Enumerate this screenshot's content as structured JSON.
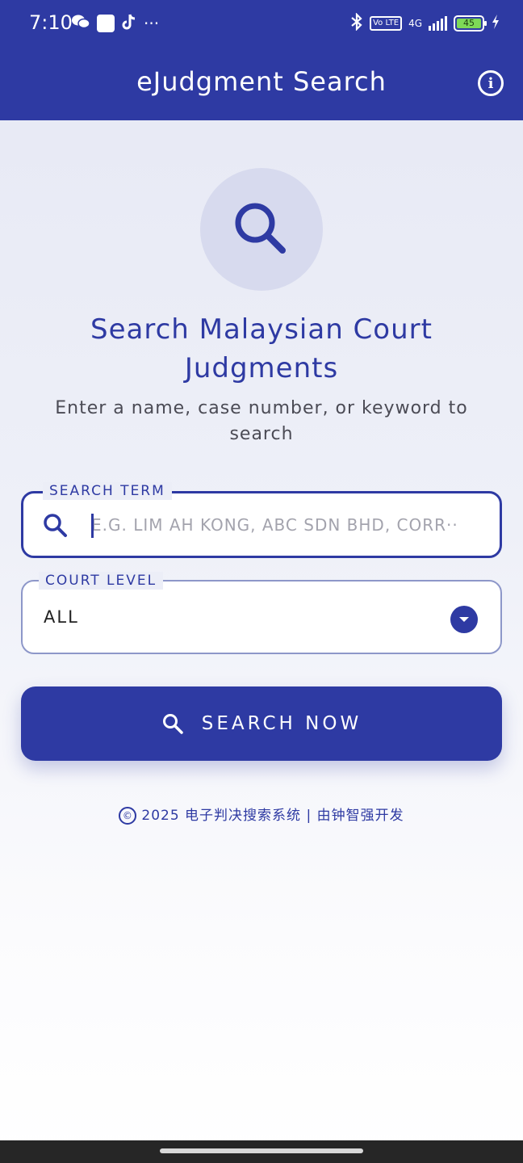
{
  "status_bar": {
    "time": "7:10",
    "more_indicator": "···",
    "volte_badge": "Vo LTE",
    "network": "4G",
    "battery_level": "45"
  },
  "app_bar": {
    "title": "eJudgment Search",
    "info_icon": "info-icon"
  },
  "hero": {
    "icon": "search-icon",
    "title": "Search Malaysian Court Judgments",
    "subtitle": "Enter a name, case number, or keyword to search"
  },
  "search_field": {
    "label": "SEARCH TERM",
    "placeholder": "E.G. LIM AH KONG, ABC SDN BHD, CORR··",
    "value": ""
  },
  "court_field": {
    "label": "COURT LEVEL",
    "value": "ALL"
  },
  "search_button": {
    "label": "SEARCH NOW"
  },
  "footer": {
    "copyright_symbol": "©",
    "text": "2025 电子判决搜索系统 | 由钟智强开发"
  },
  "colors": {
    "primary": "#2e3aa3",
    "hero_circle": "#d7daee",
    "outline_inactive": "#8d97c9"
  }
}
